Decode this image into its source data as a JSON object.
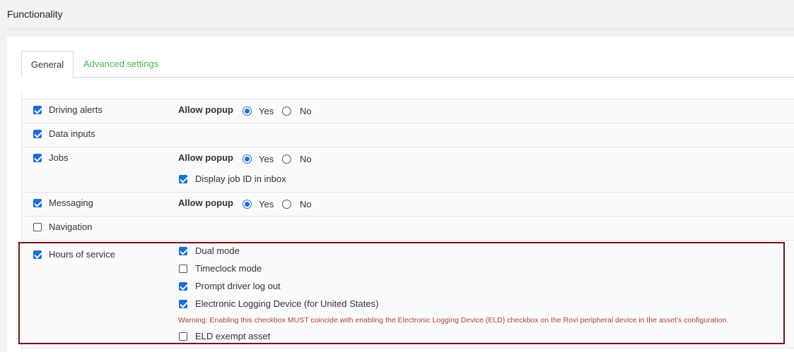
{
  "page_title": "Functionality",
  "tabs": [
    {
      "label": "General",
      "active": true
    },
    {
      "label": "Advanced settings",
      "active": false
    }
  ],
  "allow_popup_label": "Allow popup",
  "radio_yes": "Yes",
  "radio_no": "No",
  "rows": {
    "driving_alerts": {
      "label": "Driving alerts",
      "checked": true,
      "popup": "Yes"
    },
    "data_inputs": {
      "label": "Data inputs",
      "checked": true
    },
    "jobs": {
      "label": "Jobs",
      "checked": true,
      "popup": "Yes",
      "display_job_id": {
        "label": "Display job ID in inbox",
        "checked": true
      }
    },
    "messaging": {
      "label": "Messaging",
      "checked": true,
      "popup": "Yes"
    },
    "navigation": {
      "label": "Navigation",
      "checked": false
    },
    "hours_of_service": {
      "label": "Hours of service",
      "checked": true,
      "options": [
        {
          "label": "Dual mode",
          "checked": true
        },
        {
          "label": "Timeclock mode",
          "checked": false
        },
        {
          "label": "Prompt driver log out",
          "checked": true
        },
        {
          "label": "Electronic Logging Device (for United States)",
          "checked": true
        }
      ],
      "warning": "Warning: Enabling this checkbox MUST coincide with enabling the Electronic Logging Device (ELD) checkbox on the Rovi peripheral device in the asset's configuration.",
      "eld_exempt": {
        "label": "ELD exempt asset",
        "checked": false
      }
    }
  },
  "colors": {
    "accent": "#1a6fd9",
    "link": "#4caf50",
    "warning": "#a94442",
    "highlight": "#7a1111"
  }
}
